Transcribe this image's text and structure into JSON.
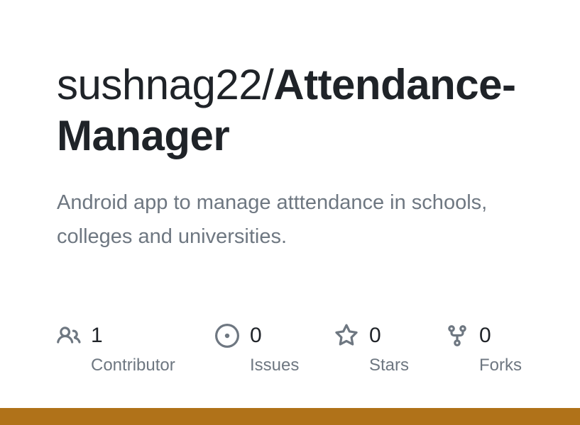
{
  "repo": {
    "owner": "sushnag22/",
    "name_line1": "Attendance-",
    "name_line2": "Manager",
    "description": "Android app to manage atttendance in schools, colleges and universities."
  },
  "stats": {
    "contributors": {
      "count": "1",
      "label": "Contributor",
      "icon": "people-icon"
    },
    "issues": {
      "count": "0",
      "label": "Issues",
      "icon": "issue-opened-icon"
    },
    "stars": {
      "count": "0",
      "label": "Stars",
      "icon": "star-icon"
    },
    "forks": {
      "count": "0",
      "label": "Forks",
      "icon": "repo-forked-icon"
    }
  },
  "colors": {
    "language_bar": "#b07219",
    "text_primary": "#1f2328",
    "text_muted": "#6e7781"
  }
}
